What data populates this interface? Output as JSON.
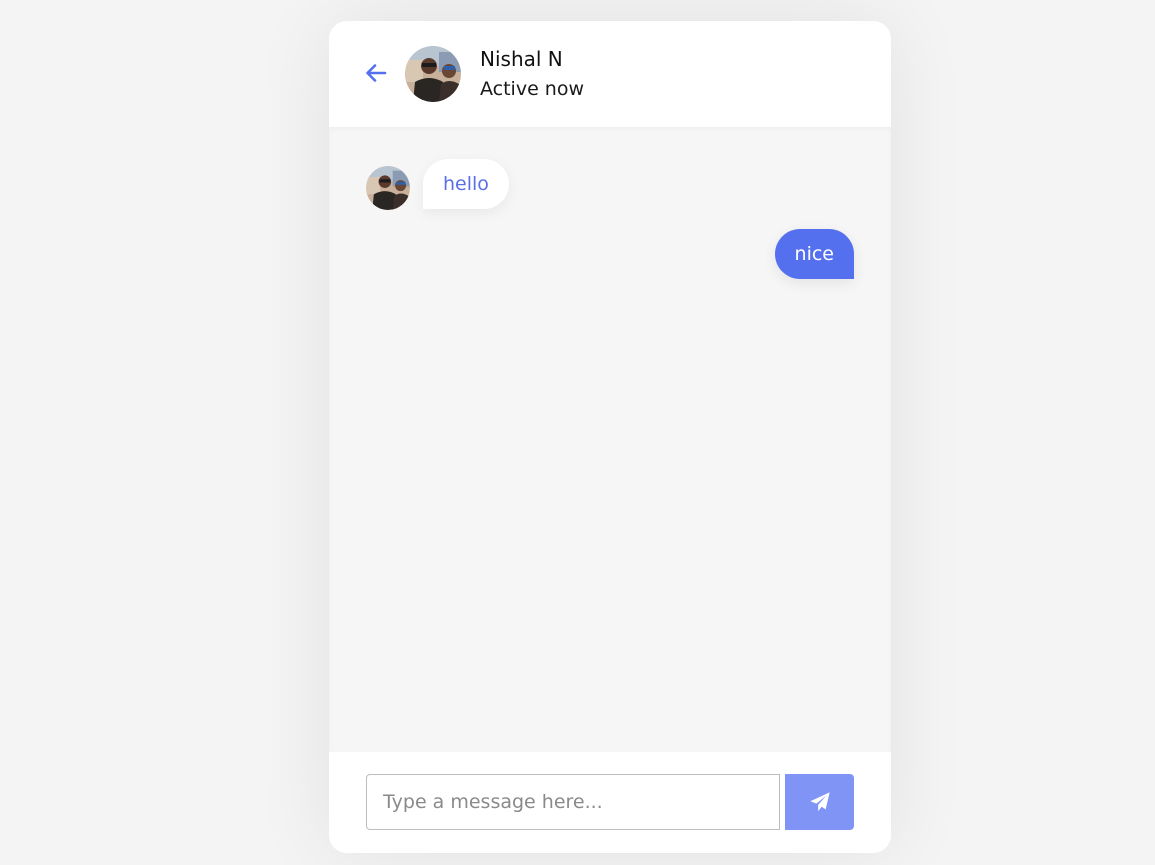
{
  "header": {
    "name": "Nishal N",
    "status": "Active now",
    "back_icon": "arrow-left-icon",
    "avatar_icon": "profile-photo"
  },
  "messages": [
    {
      "direction": "incoming",
      "text": "hello"
    },
    {
      "direction": "outgoing",
      "text": "nice"
    }
  ],
  "composer": {
    "placeholder": "Type a message here...",
    "value": "",
    "send_icon": "paper-plane-icon"
  },
  "colors": {
    "accent": "#5570ee",
    "send_button": "#8094f5",
    "incoming_text": "#5b6fe6",
    "body_bg": "#f6f6f6",
    "page_bg": "#f4f4f4"
  }
}
